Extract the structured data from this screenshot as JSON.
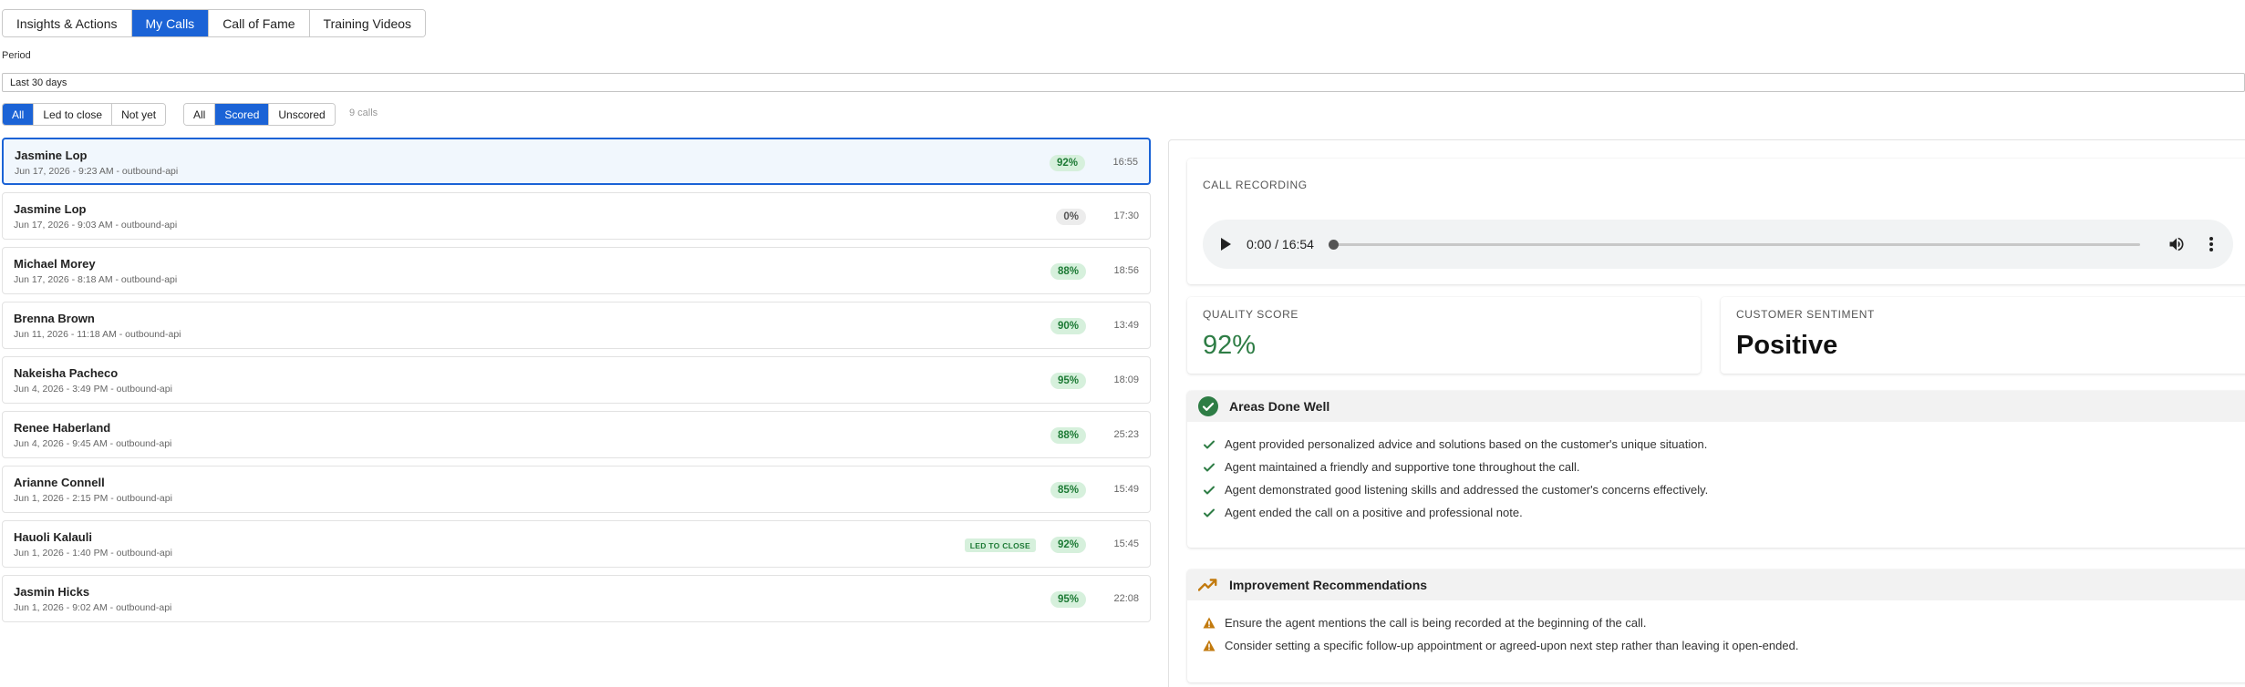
{
  "nav": {
    "tabs": [
      {
        "label": "Insights & Actions"
      },
      {
        "label": "My Calls"
      },
      {
        "label": "Call of Fame"
      },
      {
        "label": "Training Videos"
      }
    ]
  },
  "period": {
    "label": "Period",
    "value": "Last 30 days"
  },
  "filters": {
    "outcome": [
      {
        "label": "All"
      },
      {
        "label": "Led to close"
      },
      {
        "label": "Not yet"
      }
    ],
    "scoring": [
      {
        "label": "All"
      },
      {
        "label": "Scored"
      },
      {
        "label": "Unscored"
      }
    ],
    "count_label": "9 calls"
  },
  "calls": [
    {
      "name": "Jasmine Lop",
      "meta": "Jun 17, 2026 - 9:23 AM - outbound-api",
      "score": "92%",
      "duration": "16:55",
      "badge": ""
    },
    {
      "name": "Jasmine Lop",
      "meta": "Jun 17, 2026 - 9:03 AM - outbound-api",
      "score": "0%",
      "duration": "17:30",
      "badge": ""
    },
    {
      "name": "Michael Morey",
      "meta": "Jun 17, 2026 - 8:18 AM - outbound-api",
      "score": "88%",
      "duration": "18:56",
      "badge": ""
    },
    {
      "name": "Brenna Brown",
      "meta": "Jun 11, 2026 - 11:18 AM - outbound-api",
      "score": "90%",
      "duration": "13:49",
      "badge": ""
    },
    {
      "name": "Nakeisha Pacheco",
      "meta": "Jun 4, 2026 - 3:49 PM - outbound-api",
      "score": "95%",
      "duration": "18:09",
      "badge": ""
    },
    {
      "name": "Renee Haberland",
      "meta": "Jun 4, 2026 - 9:45 AM - outbound-api",
      "score": "88%",
      "duration": "25:23",
      "badge": ""
    },
    {
      "name": "Arianne Connell",
      "meta": "Jun 1, 2026 - 2:15 PM - outbound-api",
      "score": "85%",
      "duration": "15:49",
      "badge": ""
    },
    {
      "name": "Hauoli Kalauli",
      "meta": "Jun 1, 2026 - 1:40 PM - outbound-api",
      "score": "92%",
      "duration": "15:45",
      "badge": "LED TO CLOSE"
    },
    {
      "name": "Jasmin Hicks",
      "meta": "Jun 1, 2026 - 9:02 AM - outbound-api",
      "score": "95%",
      "duration": "22:08",
      "badge": ""
    }
  ],
  "detail": {
    "recording": {
      "label": "CALL RECORDING",
      "time": "0:00 / 16:54"
    },
    "quality": {
      "label": "QUALITY SCORE",
      "value": "92%"
    },
    "sentiment": {
      "label": "CUSTOMER SENTIMENT",
      "value": "Positive"
    },
    "done_well": {
      "title": "Areas Done Well",
      "items": [
        "Agent provided personalized advice and solutions based on the customer's unique situation.",
        "Agent maintained a friendly and supportive tone throughout the call.",
        "Agent demonstrated good listening skills and addressed the customer's concerns effectively.",
        "Agent ended the call on a positive and professional note."
      ]
    },
    "improvements": {
      "title": "Improvement Recommendations",
      "items": [
        "Ensure the agent mentions the call is being recorded at the beginning of the call.",
        "Consider setting a specific follow-up appointment or agreed-upon next step rather than leaving it open-ended."
      ]
    }
  },
  "colors": {
    "accent": "#1b63d6",
    "success": "#2e7d45",
    "warning": "#c27a0e"
  },
  "icons": {
    "done_well": "check-circle-icon",
    "improvements": "trending-up-icon",
    "check": "check-icon",
    "warning": "warning-icon"
  }
}
